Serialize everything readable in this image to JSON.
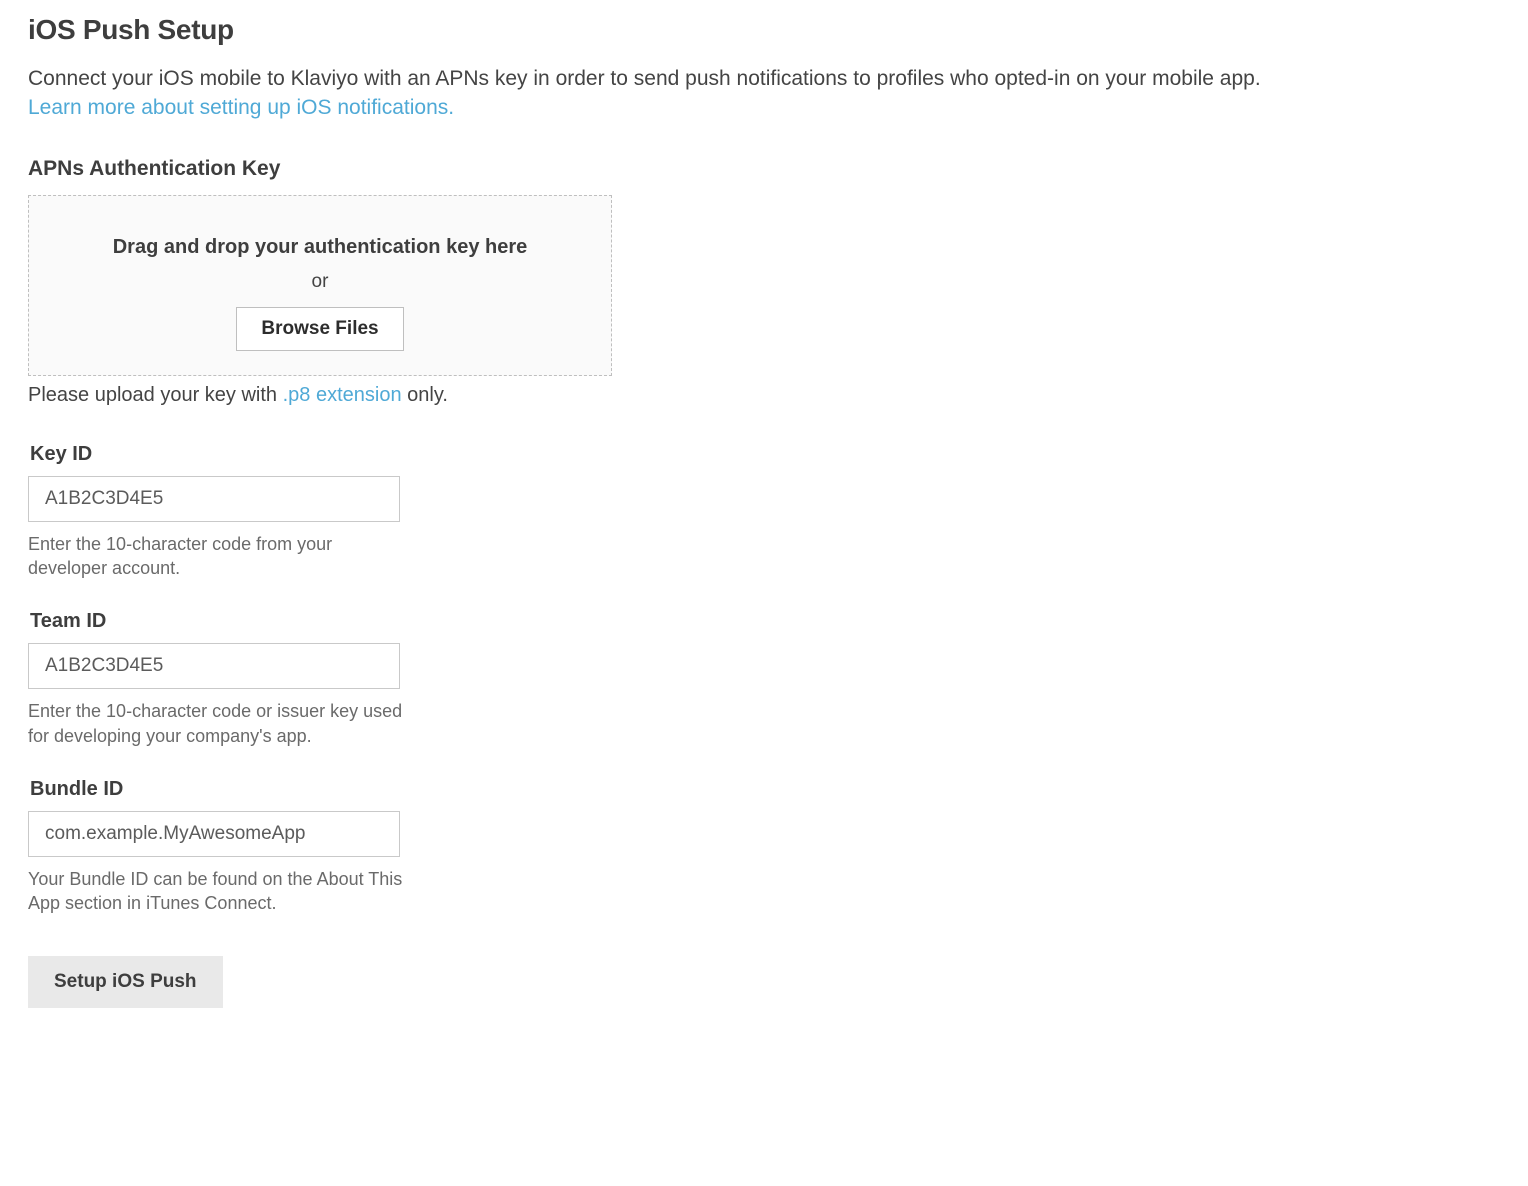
{
  "title": "iOS Push Setup",
  "intro": {
    "text": "Connect your iOS mobile to Klaviyo with an APNs key in order to send push notifications to profiles who opted-in on your mobile app.",
    "link_text": "Learn more about setting up iOS notifications."
  },
  "apns": {
    "section_label": "APNs Authentication Key",
    "drop_text": "Drag and drop your authentication key here",
    "or_text": "or",
    "browse_label": "Browse Files",
    "upload_hint_prefix": "Please upload your key with ",
    "upload_hint_ext": ".p8 extension",
    "upload_hint_suffix": " only."
  },
  "fields": {
    "key_id": {
      "label": "Key ID",
      "placeholder": "A1B2C3D4E5",
      "help": "Enter the 10-character code from your developer account."
    },
    "team_id": {
      "label": "Team ID",
      "placeholder": "A1B2C3D4E5",
      "help": "Enter the 10-character code or issuer key used for developing your company's app."
    },
    "bundle_id": {
      "label": "Bundle ID",
      "placeholder": "com.example.MyAwesomeApp",
      "help": "Your Bundle ID can be found on the About This App section in iTunes Connect."
    }
  },
  "submit_label": "Setup iOS Push"
}
